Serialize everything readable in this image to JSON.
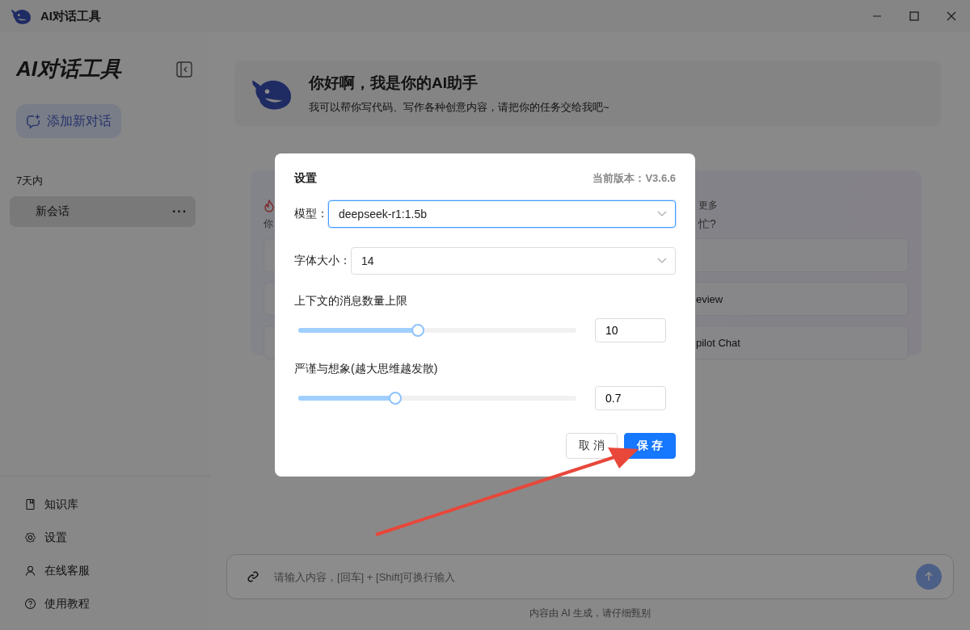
{
  "window": {
    "title": "AI对话工具"
  },
  "sidebar": {
    "title": "AI对话工具",
    "new_chat_button": "添加新对话",
    "group_label": "7天内",
    "conversations": [
      {
        "title": "新会话",
        "menu": "···",
        "selected": true
      }
    ],
    "footer_items": [
      {
        "label": "知识库"
      },
      {
        "label": "设置"
      },
      {
        "label": "在线客服"
      },
      {
        "label": "使用教程"
      }
    ]
  },
  "welcome": {
    "title": "你好啊，我是你的AI助手",
    "subtitle": "我可以帮你写代码、写作各种创意内容，请把你的任务交给我吧~"
  },
  "suggestions": {
    "left": {
      "text": "你"
    },
    "right": {
      "label": "更多",
      "text": "忙?",
      "rows": [
        {},
        {
          "text": "eview"
        },
        {
          "text": "pilot Chat"
        }
      ]
    }
  },
  "input": {
    "placeholder": "请输入内容，[回车] + [Shift]可换行输入"
  },
  "disclaimer": "内容由 AI 生成，请仔细甄别",
  "dialog": {
    "title": "设置",
    "version": "当前版本：V3.6.6",
    "model": {
      "label": "模型：",
      "value": "deepseek-r1:1.5b",
      "focused": true
    },
    "font_size": {
      "label": "字体大小：",
      "value": "14",
      "focused": false
    },
    "sliders": [
      {
        "label": "上下文的消息数量上限",
        "level": 0.43,
        "value": "10"
      },
      {
        "label": "严谨与想象(越大思维越发散)",
        "level": 0.35,
        "value": "0.7"
      }
    ],
    "buttons": [
      {
        "label": "取 消",
        "kind": "default"
      },
      {
        "label": "保 存",
        "kind": "primary"
      }
    ]
  }
}
